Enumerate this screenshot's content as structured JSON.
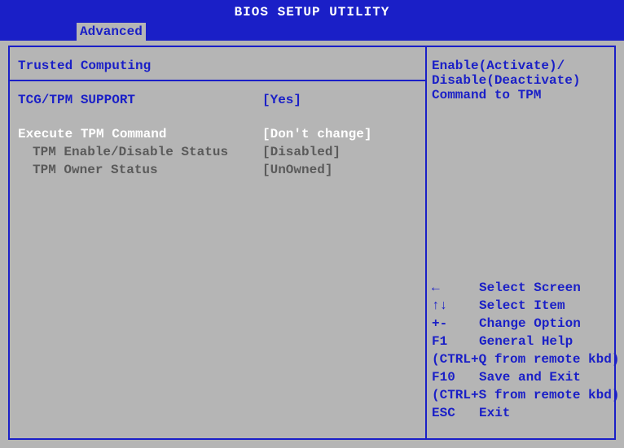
{
  "title": "BIOS SETUP UTILITY",
  "tab": "Advanced",
  "main": {
    "section_title": "Trusted Computing",
    "tcg_label": "TCG/TPM SUPPORT",
    "tcg_value": "[Yes]",
    "exec_label": "Execute TPM Command",
    "exec_value": "[Don't change]",
    "tpm_enable_label": "TPM Enable/Disable Status",
    "tpm_enable_value": "[Disabled]",
    "tpm_owner_label": "TPM Owner Status",
    "tpm_owner_value": "[UnOwned]"
  },
  "help": {
    "line1": "Enable(Activate)/",
    "line2": "Disable(Deactivate)",
    "line3": "Command to TPM"
  },
  "keys": {
    "k1": "←",
    "d1": "Select Screen",
    "k2": "↑↓",
    "d2": "Select Item",
    "k3": "+-",
    "d3": "Change Option",
    "k4": "F1",
    "d4": "General Help",
    "note1": "(CTRL+Q from remote kbd)",
    "k5": "F10",
    "d5": "Save and Exit",
    "note2": "(CTRL+S from remote kbd)",
    "k6": "ESC",
    "d6": "Exit"
  }
}
